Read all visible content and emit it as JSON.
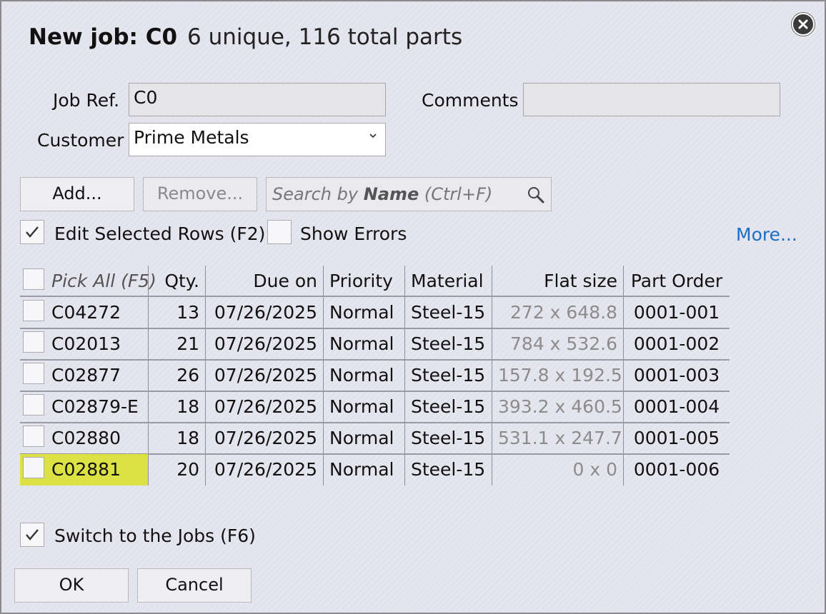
{
  "dialog": {
    "title_job": "New job: C0",
    "title_sub": "6 unique, 116 total parts"
  },
  "form": {
    "job_ref_label": "Job Ref.",
    "job_ref_value": "C0",
    "comments_label": "Comments",
    "comments_value": "",
    "customer_label": "Customer",
    "customer_value": "Prime Metals"
  },
  "toolbar": {
    "add_label": "Add...",
    "remove_label": "Remove...",
    "search_bold": "Name",
    "search_pre": "Search by ",
    "search_post": " (Ctrl+F)"
  },
  "options": {
    "edit_selected_label": "Edit Selected Rows (F2)",
    "edit_selected_checked": true,
    "show_errors_label": "Show Errors",
    "show_errors_checked": false,
    "more_label": "More..."
  },
  "table": {
    "headers": {
      "pick": "Pick All (F5)",
      "qty": "Qty.",
      "due": "Due on",
      "priority": "Priority",
      "material": "Material",
      "flat": "Flat size",
      "order": "Part Order"
    },
    "rows": [
      {
        "name": "C04272",
        "qty": "13",
        "due": "07/26/2025",
        "priority": "Normal",
        "material": "Steel-15",
        "flat": "272 x 648.8",
        "order": "0001-001"
      },
      {
        "name": "C02013",
        "qty": "21",
        "due": "07/26/2025",
        "priority": "Normal",
        "material": "Steel-15",
        "flat": "784 x 532.6",
        "order": "0001-002"
      },
      {
        "name": "C02877",
        "qty": "26",
        "due": "07/26/2025",
        "priority": "Normal",
        "material": "Steel-15",
        "flat": "157.8 x 192.5",
        "order": "0001-003"
      },
      {
        "name": "C02879-E",
        "qty": "18",
        "due": "07/26/2025",
        "priority": "Normal",
        "material": "Steel-15",
        "flat": "393.2 x 460.5",
        "order": "0001-004"
      },
      {
        "name": "C02880",
        "qty": "18",
        "due": "07/26/2025",
        "priority": "Normal",
        "material": "Steel-15",
        "flat": "531.1 x 247.7",
        "order": "0001-005"
      },
      {
        "name": "C02881",
        "qty": "20",
        "due": "07/26/2025",
        "priority": "Normal",
        "material": "Steel-15",
        "flat": "0 x 0",
        "order": "0001-006"
      }
    ],
    "highlight_color": "#dde244"
  },
  "footer": {
    "switch_label": "Switch to the Jobs (F6)",
    "switch_checked": true,
    "ok_label": "OK",
    "cancel_label": "Cancel"
  },
  "icons": {
    "close": "close-icon",
    "dropdown": "chevron-down-icon",
    "search": "magnifier-icon",
    "check": "checkmark-icon"
  },
  "colors": {
    "link": "#1a6fc4",
    "dialog_bg": "#e2e3ec"
  }
}
